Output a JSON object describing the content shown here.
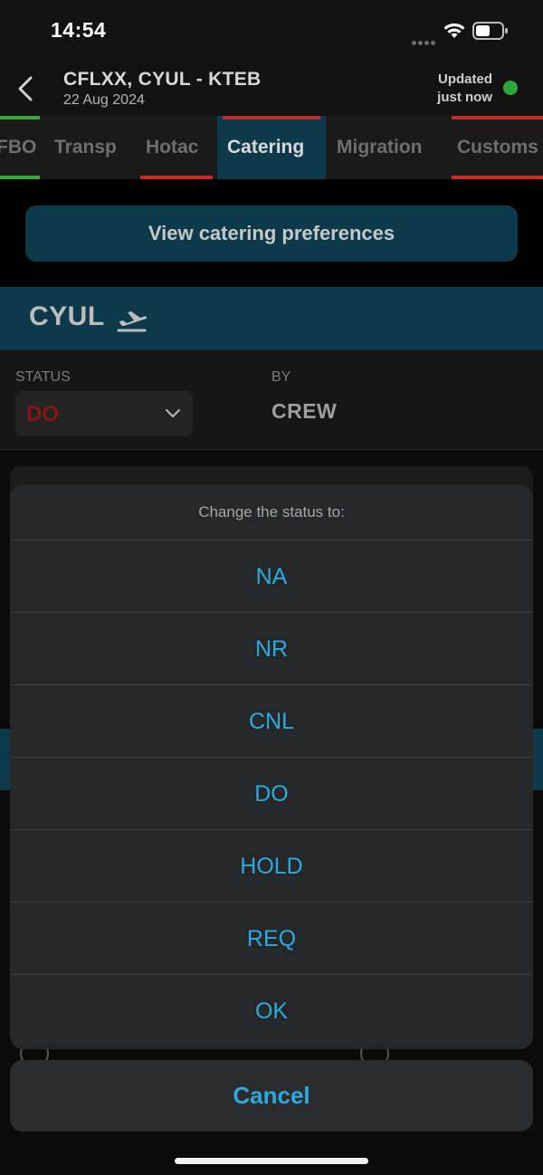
{
  "status_bar": {
    "time": "14:54"
  },
  "header": {
    "title": "CFLXX, CYUL - KTEB",
    "subtitle": "22 Aug 2024",
    "updated_line1": "Updated",
    "updated_line2": "just now"
  },
  "tabs": [
    {
      "label": "FBO",
      "indicator_top": "#3aa639",
      "indicator_bottom": "#3aa639",
      "active": false
    },
    {
      "label": "Transp",
      "indicator_top": "",
      "indicator_bottom": "",
      "active": false
    },
    {
      "label": "Hotac",
      "indicator_top": "",
      "indicator_bottom": "#c42b2b",
      "active": false
    },
    {
      "label": "Catering",
      "indicator_top": "#c42b2b",
      "indicator_bottom": "",
      "active": true
    },
    {
      "label": "Migration",
      "indicator_top": "",
      "indicator_bottom": "",
      "active": false
    },
    {
      "label": "Customs",
      "indicator_top": "#c42b2b",
      "indicator_bottom": "#c42b2b",
      "active": false
    }
  ],
  "preferences_button": "View catering preferences",
  "station": {
    "code": "CYUL",
    "icon": "takeoff-icon"
  },
  "status_section": {
    "status_label": "STATUS",
    "status_value": "DO",
    "by_label": "BY",
    "by_value": "CREW"
  },
  "action_sheet": {
    "title": "Change the status to:",
    "options": [
      "NA",
      "NR",
      "CNL",
      "DO",
      "HOLD",
      "REQ",
      "OK"
    ],
    "cancel": "Cancel"
  },
  "colors": {
    "teal": "#0c3a4b",
    "link_blue": "#2ea9e0",
    "status_red": "#8b1515",
    "online_green": "#2fa53a"
  }
}
